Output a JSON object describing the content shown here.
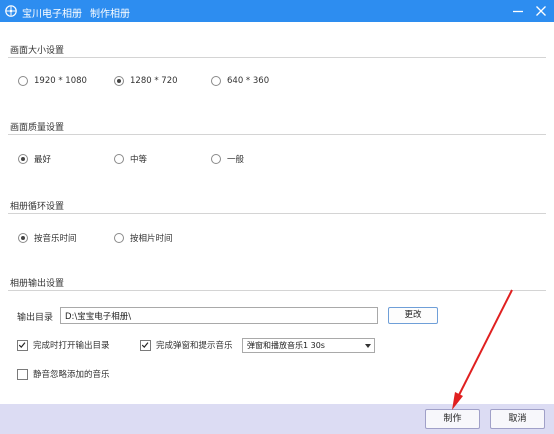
{
  "window": {
    "app_name": "宝川电子相册",
    "dialog_title": "制作相册",
    "colors": {
      "titlebar": "#2d8df0",
      "footer": "#dcdcf3",
      "annotation": "#e02020"
    },
    "icons": {
      "app": "app-logo-icon",
      "minimize": "minimize-icon",
      "close": "close-icon"
    }
  },
  "size_section": {
    "title": "画面大小设置",
    "options": [
      {
        "label": "1920 * 1080",
        "selected": false
      },
      {
        "label": "1280 * 720",
        "selected": true
      },
      {
        "label": "640 * 360",
        "selected": false
      }
    ]
  },
  "quality_section": {
    "title": "画面质量设置",
    "options": [
      {
        "label": "最好",
        "selected": true
      },
      {
        "label": "中等",
        "selected": false
      },
      {
        "label": "一般",
        "selected": false
      }
    ]
  },
  "loop_section": {
    "title": "相册循环设置",
    "options": [
      {
        "label": "按音乐时间",
        "selected": true
      },
      {
        "label": "按相片时间",
        "selected": false
      }
    ]
  },
  "output_section": {
    "title": "相册输出设置",
    "dir_label": "输出目录",
    "dir_value": "D:\\宝宝电子相册\\",
    "change_button": "更改",
    "open_dir_label": "完成时打开输出目录",
    "open_dir_checked": true,
    "popup_label": "完成弹窗和提示音乐",
    "popup_checked": true,
    "popup_select_value": "弹窗和播放音乐1  30s",
    "mute_label": "静音忽略添加的音乐",
    "mute_checked": false
  },
  "footer": {
    "make_button": "制作",
    "cancel_button": "取消"
  }
}
